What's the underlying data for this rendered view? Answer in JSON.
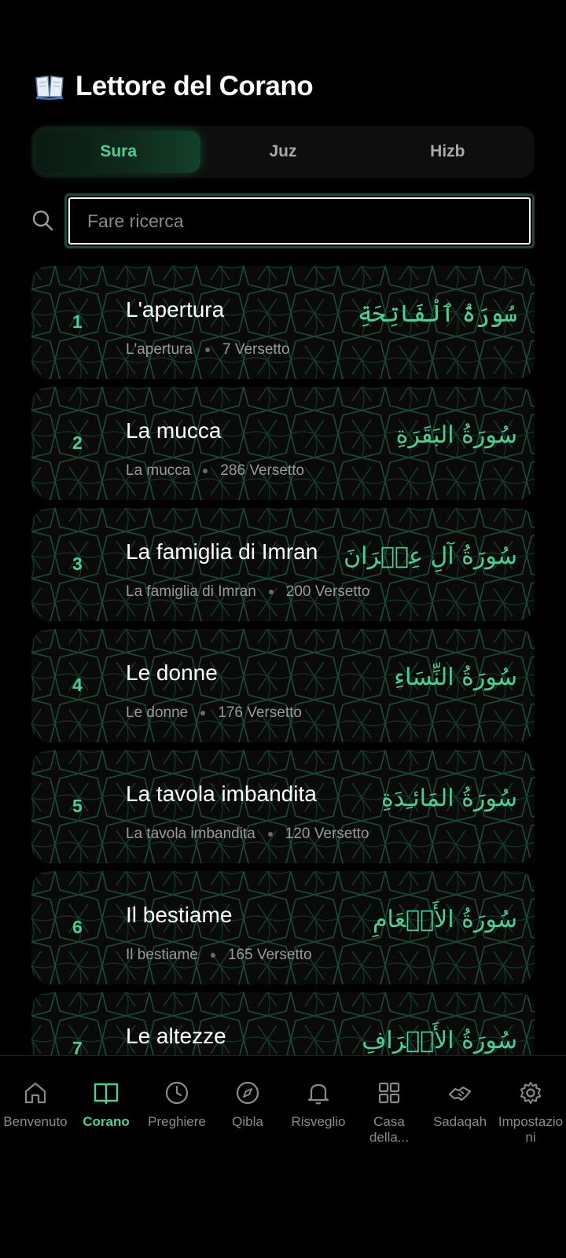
{
  "header": {
    "icon": "open-book-icon",
    "title": "Lettore del Corano"
  },
  "tabs": [
    {
      "label": "Sura",
      "active": true
    },
    {
      "label": "Juz",
      "active": false
    },
    {
      "label": "Hizb",
      "active": false
    }
  ],
  "search": {
    "placeholder": "Fare ricerca",
    "value": ""
  },
  "surahs": [
    {
      "number": "1",
      "name": "L'apertura",
      "translation": "L'apertura",
      "verses": "7 Versetto",
      "arabic": "سُورَةُ ٱلْفَاتِحَةِ"
    },
    {
      "number": "2",
      "name": "La mucca",
      "translation": "La mucca",
      "verses": "286 Versetto",
      "arabic": "سُورَةُ البَقَرَةِ"
    },
    {
      "number": "3",
      "name": "La famiglia di Imran",
      "translation": "La famiglia di Imran",
      "verses": "200 Versetto",
      "arabic": "سُورَةُ آلِ عِمۡرَانَ"
    },
    {
      "number": "4",
      "name": "Le donne",
      "translation": "Le donne",
      "verses": "176 Versetto",
      "arabic": "سُورَةُ النِّسَاءِ"
    },
    {
      "number": "5",
      "name": "La tavola imbandita",
      "translation": "La tavola imbandita",
      "verses": "120 Versetto",
      "arabic": "سُورَةُ المَائـِدَةِ"
    },
    {
      "number": "6",
      "name": "Il bestiame",
      "translation": "Il bestiame",
      "verses": "165 Versetto",
      "arabic": "سُورَةُ الأَنۡعَامِ"
    },
    {
      "number": "7",
      "name": "Le altezze",
      "translation": "",
      "verses": "",
      "arabic": "سُورَةُ الأَعۡرَافِ"
    }
  ],
  "nav": [
    {
      "label": "Benvenuto",
      "icon": "home-icon",
      "active": false
    },
    {
      "label": "Corano",
      "icon": "book-icon",
      "active": true
    },
    {
      "label": "Preghiere",
      "icon": "clock-icon",
      "active": false
    },
    {
      "label": "Qibla",
      "icon": "compass-icon",
      "active": false
    },
    {
      "label": "Risveglio",
      "icon": "bell-icon",
      "active": false
    },
    {
      "label": "Casa della...",
      "icon": "grid-icon",
      "active": false
    },
    {
      "label": "Sadaqah",
      "icon": "handshake-icon",
      "active": false
    },
    {
      "label": "Impostazioni",
      "icon": "gear-icon",
      "active": false
    }
  ],
  "colors": {
    "accent": "#4ecf92",
    "background": "#000000",
    "card": "#0a0a0a",
    "pattern": "#1b4a35"
  }
}
